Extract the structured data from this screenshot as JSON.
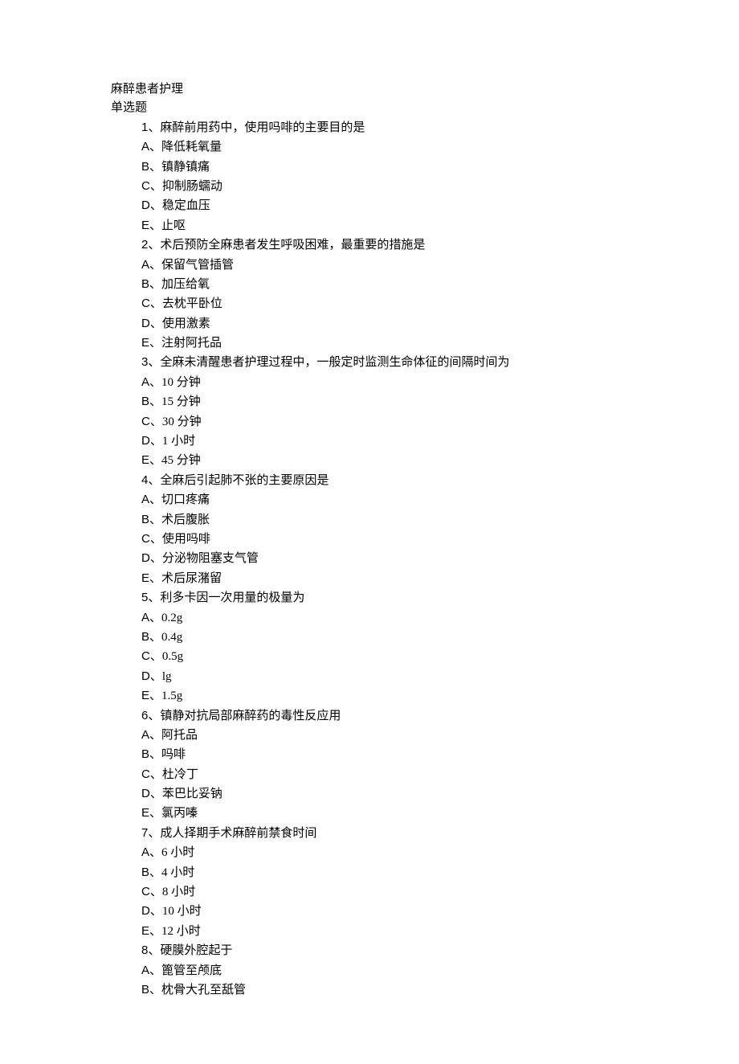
{
  "title": "麻醉患者护理",
  "section": "单选题",
  "questions": [
    {
      "num": "1",
      "text": "麻醉前用药中，使用吗啡的主要目的是",
      "options": [
        {
          "label": "A",
          "text": "降低耗氧量"
        },
        {
          "label": "B",
          "text": "镇静镇痛"
        },
        {
          "label": "C",
          "text": "抑制肠蠕动"
        },
        {
          "label": "D",
          "text": "稳定血压"
        },
        {
          "label": "E",
          "text": "止呕"
        }
      ]
    },
    {
      "num": "2",
      "text": "术后预防全麻患者发生呼吸困难，最重要的措施是",
      "options": [
        {
          "label": "A",
          "text": "保留气管插管"
        },
        {
          "label": "B",
          "text": "加压给氧"
        },
        {
          "label": "C",
          "text": "去枕平卧位"
        },
        {
          "label": "D",
          "text": "使用激素"
        },
        {
          "label": "E",
          "text": "注射阿托品"
        }
      ]
    },
    {
      "num": "3",
      "text": "全麻未清醒患者护理过程中，一般定时监测生命体征的间隔时间为",
      "options": [
        {
          "label": "A",
          "text": "10 分钟"
        },
        {
          "label": "B",
          "text": "15 分钟"
        },
        {
          "label": "C",
          "text": "30 分钟"
        },
        {
          "label": "D",
          "text": "1 小时"
        },
        {
          "label": "E",
          "text": "45 分钟"
        }
      ]
    },
    {
      "num": "4",
      "text": "全麻后引起肺不张的主要原因是",
      "options": [
        {
          "label": "A",
          "text": "切口疼痛"
        },
        {
          "label": "B",
          "text": "术后腹胀"
        },
        {
          "label": "C",
          "text": "使用吗啡"
        },
        {
          "label": "D",
          "text": "分泌物阻塞支气管"
        },
        {
          "label": "E",
          "text": "术后尿潴留"
        }
      ]
    },
    {
      "num": "5",
      "text": "利多卡因一次用量的极量为",
      "options": [
        {
          "label": "A",
          "text": "0.2g"
        },
        {
          "label": "B",
          "text": "0.4g"
        },
        {
          "label": "C",
          "text": "0.5g"
        },
        {
          "label": "D",
          "text": "lg"
        },
        {
          "label": "E",
          "text": "1.5g"
        }
      ]
    },
    {
      "num": "6",
      "text": "镇静对抗局部麻醉药的毒性反应用",
      "options": [
        {
          "label": "A",
          "text": "阿托品"
        },
        {
          "label": "B",
          "text": "吗啡"
        },
        {
          "label": "C",
          "text": "杜冷丁"
        },
        {
          "label": "D",
          "text": "苯巴比妥钠"
        },
        {
          "label": "E",
          "text": "氯丙嗪"
        }
      ]
    },
    {
      "num": "7",
      "text": "成人择期手术麻醉前禁食时间",
      "options": [
        {
          "label": "A",
          "text": "6 小时"
        },
        {
          "label": "B",
          "text": "4 小时"
        },
        {
          "label": "C",
          "text": "8 小时"
        },
        {
          "label": "D",
          "text": "10 小时"
        },
        {
          "label": "E",
          "text": "12 小时"
        }
      ]
    },
    {
      "num": "8",
      "text": "硬膜外腔起于",
      "options": [
        {
          "label": "A",
          "text": "篦管至颅底"
        },
        {
          "label": "B",
          "text": "枕骨大孔至舐管"
        }
      ]
    }
  ]
}
